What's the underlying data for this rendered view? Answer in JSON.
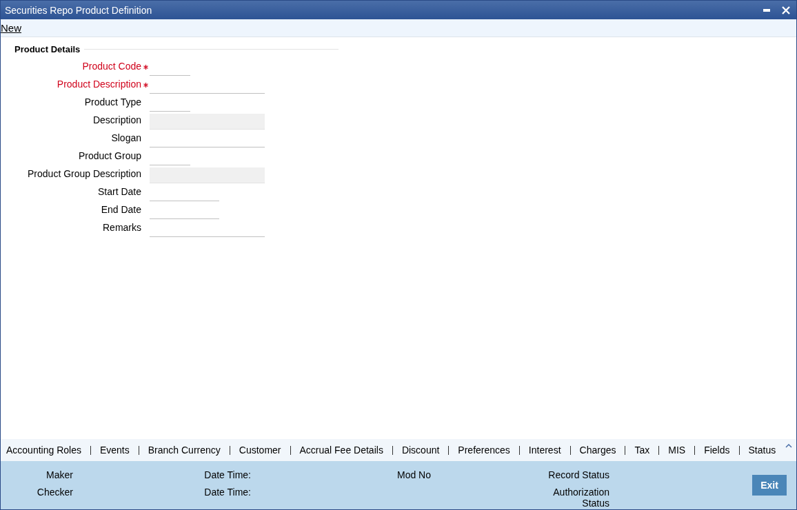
{
  "window": {
    "title": "Securities Repo Product Definition"
  },
  "toolbar": {
    "link": "New"
  },
  "section": {
    "title": "Product Details"
  },
  "fields": [
    {
      "label": "Product Code",
      "required": true,
      "kind": "short",
      "readonly": false
    },
    {
      "label": "Product Description",
      "required": true,
      "kind": "long",
      "readonly": false
    },
    {
      "label": "Product Type",
      "required": false,
      "kind": "short",
      "readonly": false
    },
    {
      "label": "Description",
      "required": false,
      "kind": "long",
      "readonly": true
    },
    {
      "label": "Slogan",
      "required": false,
      "kind": "long",
      "readonly": false
    },
    {
      "label": "Product Group",
      "required": false,
      "kind": "short",
      "readonly": false
    },
    {
      "label": "Product Group Description",
      "required": false,
      "kind": "long",
      "readonly": true
    },
    {
      "label": "Start Date",
      "required": false,
      "kind": "medium",
      "readonly": false
    },
    {
      "label": "End Date",
      "required": false,
      "kind": "medium",
      "readonly": false
    },
    {
      "label": "Remarks",
      "required": false,
      "kind": "long",
      "readonly": false
    }
  ],
  "tabs": [
    "Accounting Roles",
    "Events",
    "Branch Currency",
    "Customer",
    "Accrual Fee Details",
    "Discount",
    "Preferences",
    "Interest",
    "Charges",
    "Tax",
    "MIS",
    "Fields",
    "Status"
  ],
  "audit": {
    "columns": [
      [
        "Maker",
        "Checker"
      ],
      [
        "Date Time:",
        "Date Time:"
      ],
      [
        "Mod No"
      ],
      [
        "Record Status",
        "Authorization Status"
      ]
    ],
    "button": "Exit"
  }
}
